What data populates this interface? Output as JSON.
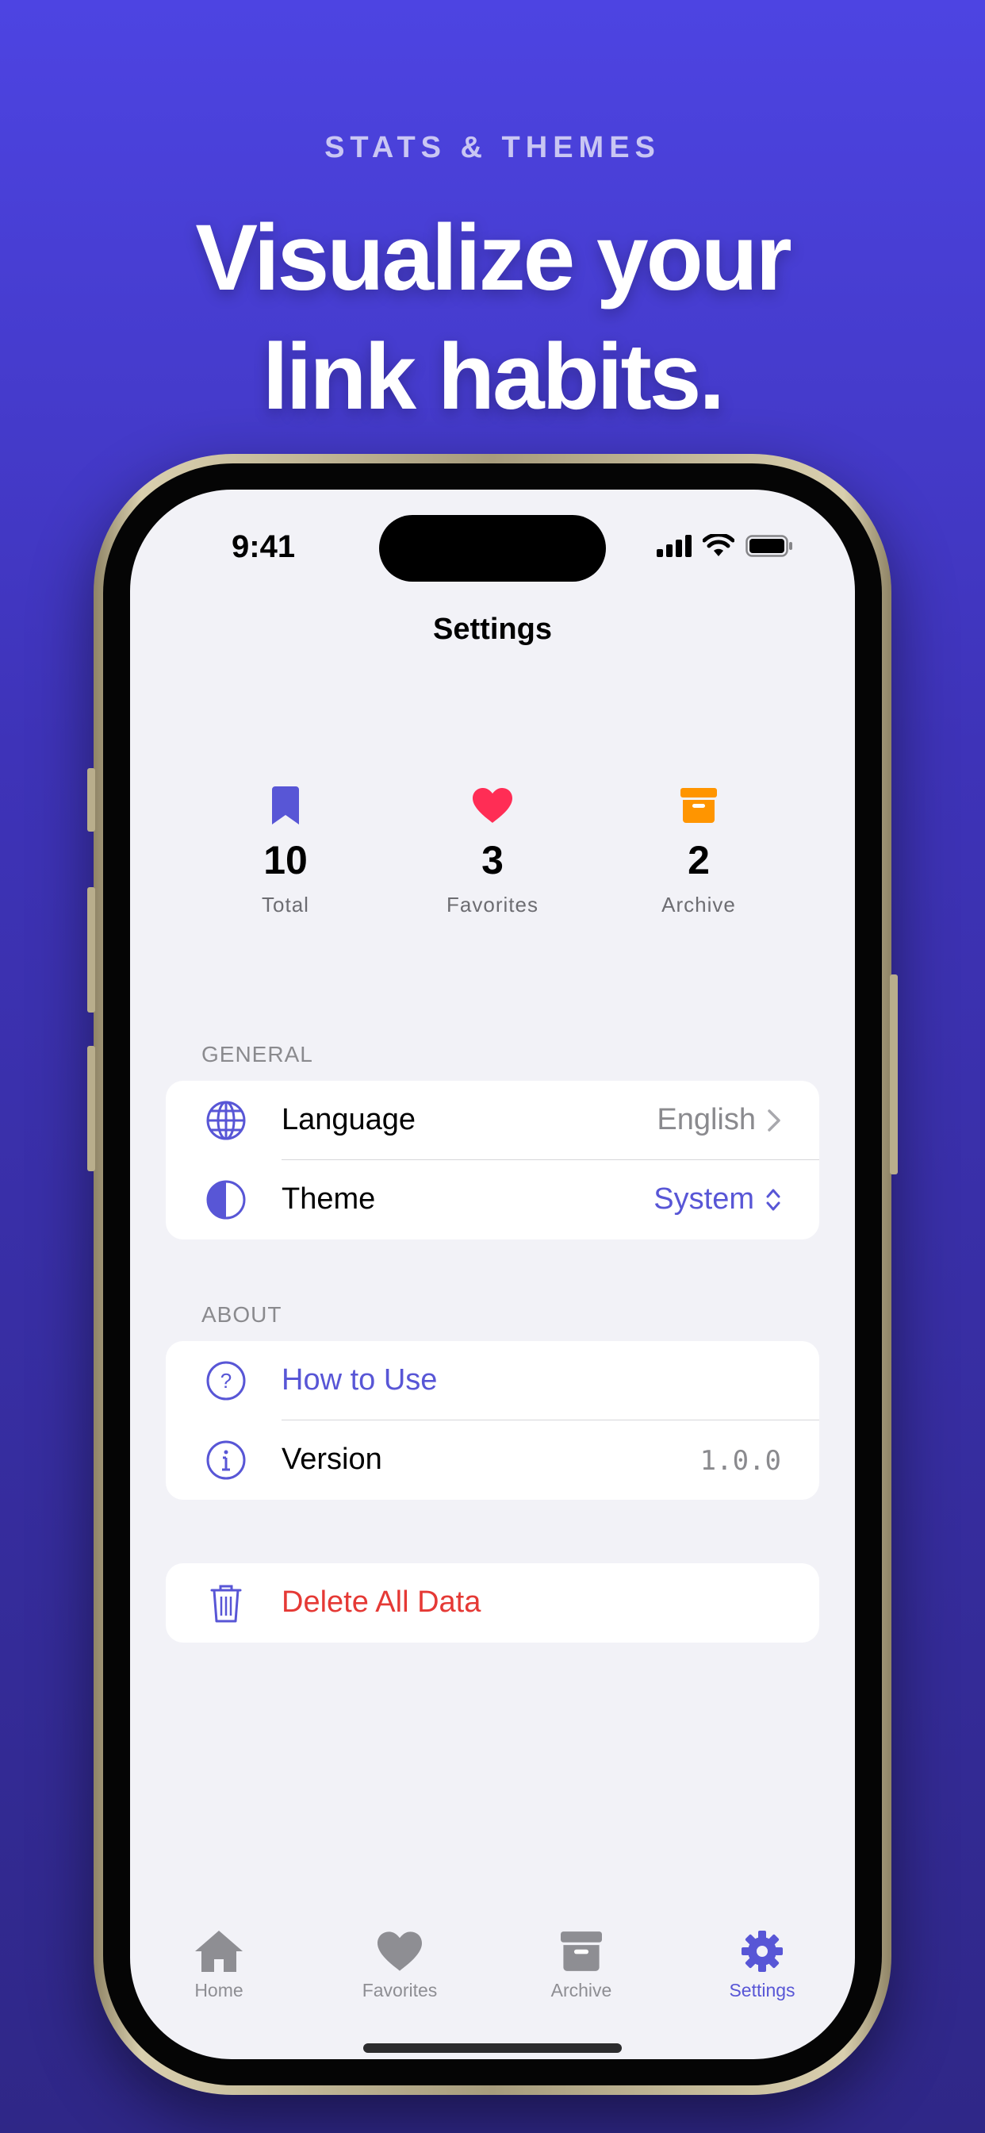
{
  "promo": {
    "kicker": "STATS & THEMES",
    "headline_line1": "Visualize your",
    "headline_line2": "link habits."
  },
  "status_bar": {
    "time": "9:41"
  },
  "nav": {
    "title": "Settings"
  },
  "stats": [
    {
      "value": "10",
      "label": "Total",
      "icon": "bookmark-icon",
      "color": "#5856d6"
    },
    {
      "value": "3",
      "label": "Favorites",
      "icon": "heart-icon",
      "color": "#ff2d55"
    },
    {
      "value": "2",
      "label": "Archive",
      "icon": "archive-icon",
      "color": "#ff9500"
    }
  ],
  "general": {
    "header": "GENERAL",
    "language": {
      "label": "Language",
      "value": "English"
    },
    "theme": {
      "label": "Theme",
      "value": "System"
    }
  },
  "about": {
    "header": "ABOUT",
    "how_to_use": {
      "label": "How to Use"
    },
    "version": {
      "label": "Version",
      "value": "1.0.0"
    }
  },
  "danger": {
    "delete_label": "Delete All Data"
  },
  "tabs": [
    {
      "label": "Home",
      "icon": "home-icon"
    },
    {
      "label": "Favorites",
      "icon": "heart-icon"
    },
    {
      "label": "Archive",
      "icon": "archive-icon"
    },
    {
      "label": "Settings",
      "icon": "gear-icon"
    }
  ],
  "colors": {
    "accent": "#5856d6",
    "destructive": "#e53935",
    "secondary_text": "#8a8a8e",
    "tab_inactive": "#8e8e93"
  }
}
